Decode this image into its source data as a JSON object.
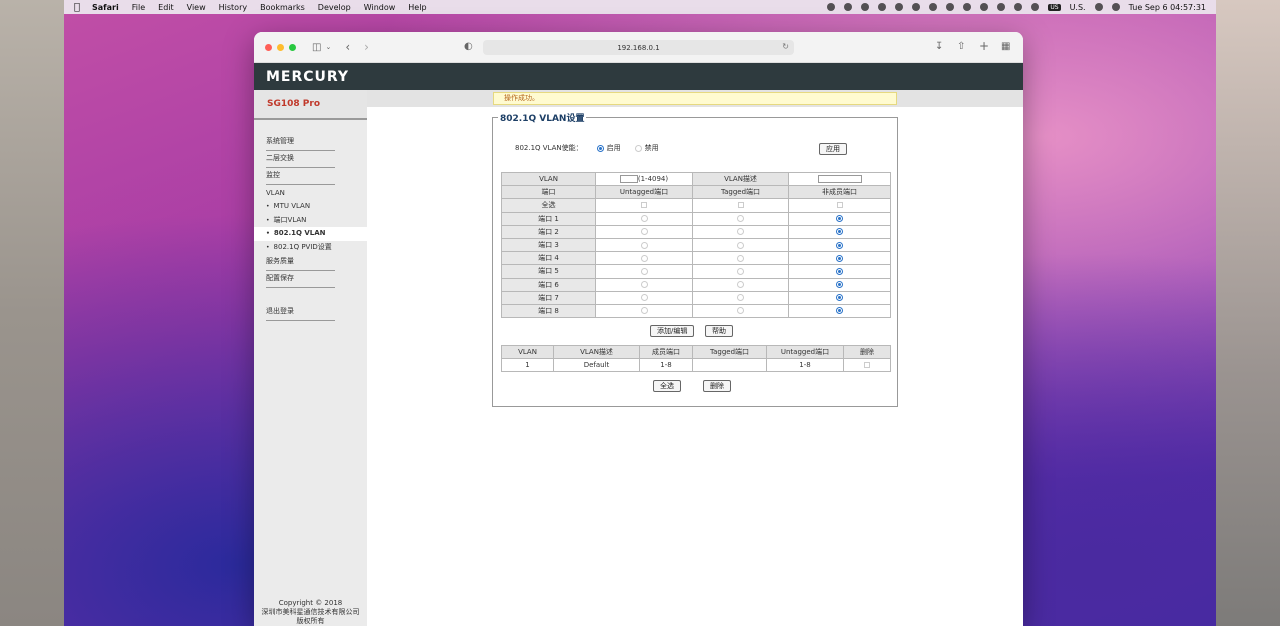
{
  "menubar": {
    "app": "Safari",
    "items": [
      "File",
      "Edit",
      "View",
      "History",
      "Bookmarks",
      "Develop",
      "Window",
      "Help"
    ],
    "lang": "US",
    "lang_label": "U.S.",
    "datetime": "Tue Sep 6  04:57:31"
  },
  "browser": {
    "url": "192.168.0.1"
  },
  "router": {
    "brand": "MERCURY",
    "model": "SG108 Pro",
    "success_msg": "操作成功。",
    "nav": {
      "system": "系统管理",
      "l2": "二层交换",
      "monitor": "监控",
      "vlan": "VLAN",
      "mtu_vlan": "MTU VLAN",
      "port_vlan": "端口VLAN",
      "q_vlan": "802.1Q VLAN",
      "pvid": "802.1Q PVID设置",
      "qos": "服务质量",
      "save": "配置保存",
      "logout": "退出登录"
    },
    "copyright": {
      "line1": "Copyright © 2018",
      "line2": "深圳市美科星通信技术有限公司",
      "line3": "版权所有"
    }
  },
  "panel": {
    "title": "802.1Q VLAN设置",
    "enable_label": "802.1Q VLAN使能：",
    "enable_on": "启用",
    "enable_off": "禁用",
    "apply_button": "应用",
    "config_table": {
      "vlan_label": "VLAN",
      "vlan_range": "(1-4094)",
      "vlan_desc_label": "VLAN描述",
      "port_col": "端口",
      "untagged_col": "Untagged端口",
      "tagged_col": "Tagged端口",
      "nonmember_col": "非成员端口",
      "select_all": "全选",
      "ports": [
        "端口 1",
        "端口 2",
        "端口 3",
        "端口 4",
        "端口 5",
        "端口 6",
        "端口 7",
        "端口 8"
      ]
    },
    "add_edit_button": "添加/编辑",
    "help_button": "帮助",
    "list_table": {
      "headers": [
        "VLAN",
        "VLAN描述",
        "成员端口",
        "Tagged端口",
        "Untagged端口",
        "删除"
      ],
      "rows": [
        {
          "vlan": "1",
          "desc": "Default",
          "members": "1-8",
          "tagged": "",
          "untagged": "1-8"
        }
      ]
    },
    "select_all_button": "全选",
    "delete_button": "删除"
  }
}
